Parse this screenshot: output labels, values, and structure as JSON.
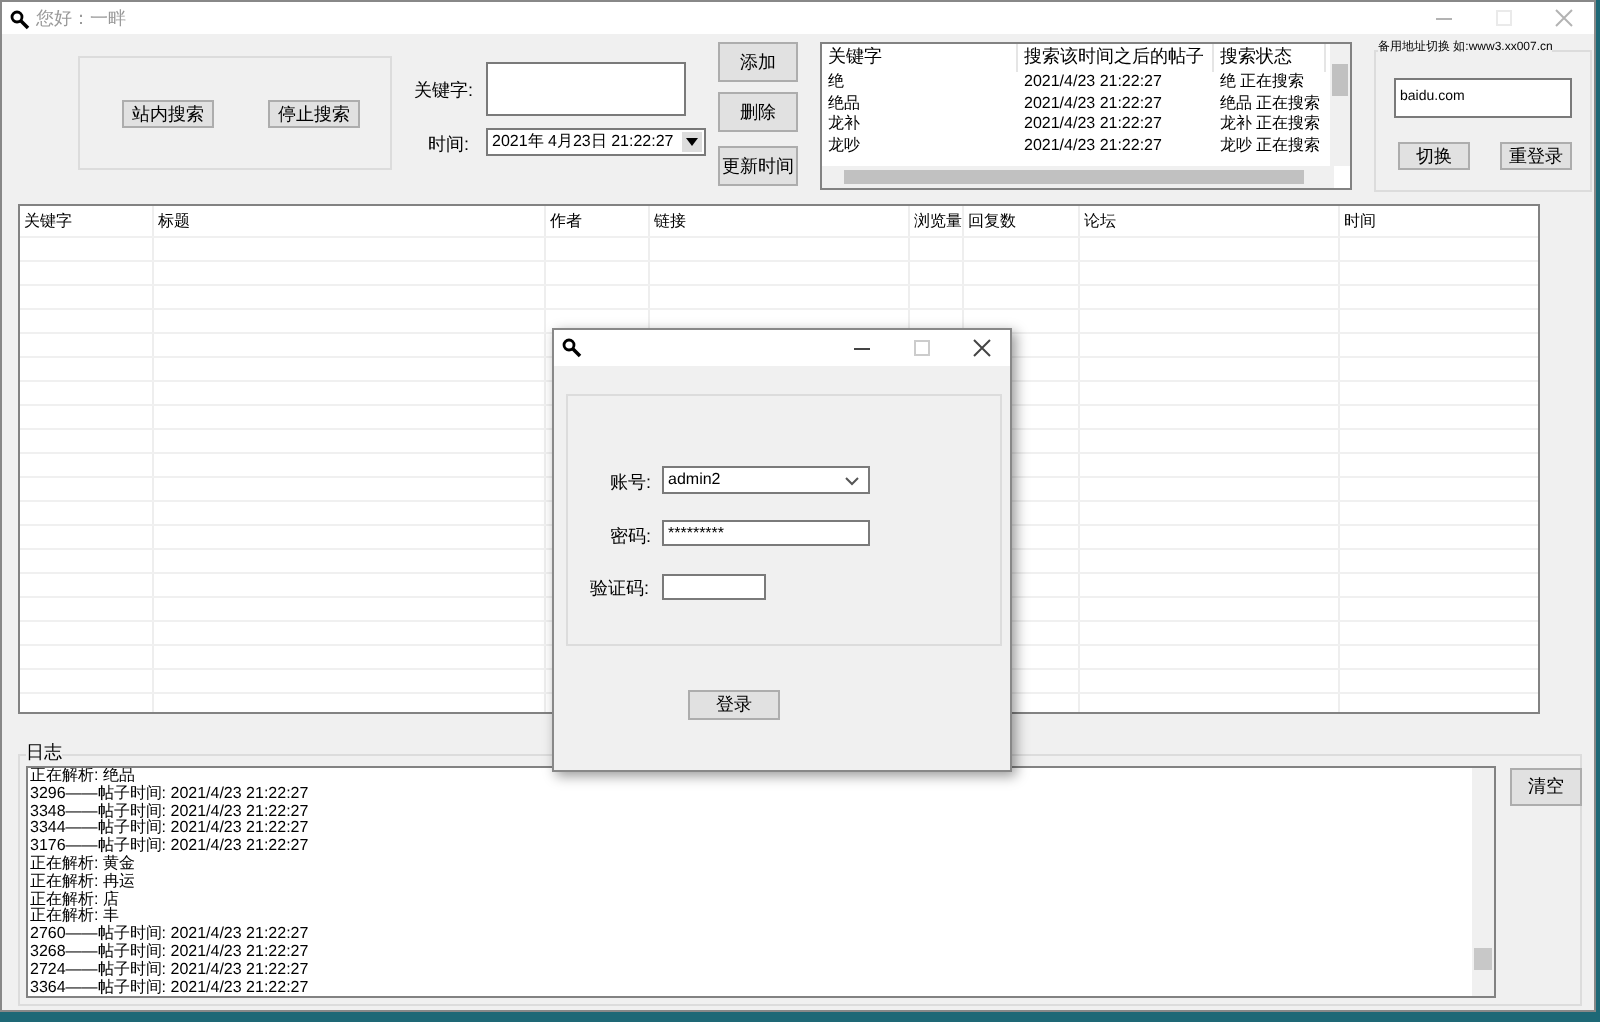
{
  "window": {
    "title": "您好：一畔"
  },
  "search_buttons": [
    "站内搜索",
    "停止搜索"
  ],
  "keyword_field": {
    "label": "关键字:"
  },
  "time_field": {
    "label": "时间:",
    "value": "2021年 4月23日 21:22:27"
  },
  "side_buttons": [
    "添加",
    "删除",
    "更新时间"
  ],
  "keyword_list": {
    "columns": [
      "关键字",
      "搜索该时间之后的帖子",
      "搜索状态"
    ],
    "rows": [
      [
        "绝",
        "2021/4/23 21:22:27",
        "绝 正在搜索"
      ],
      [
        "绝品",
        "2021/4/23 21:22:27",
        "绝品 正在搜索"
      ],
      [
        "龙补",
        "2021/4/23 21:22:27",
        "龙补 正在搜索"
      ],
      [
        "龙吵",
        "2021/4/23 21:22:27",
        "龙吵 正在搜索"
      ]
    ]
  },
  "backup": {
    "title": "备用地址切换 如:www3.xx007.cn",
    "value": "baidu.com",
    "buttons": [
      "切换",
      "重登录"
    ]
  },
  "table": {
    "columns": [
      "关键字",
      "标题",
      "作者",
      "链接",
      "浏览量",
      "回复数",
      "论坛",
      "时间"
    ]
  },
  "log": {
    "title": "日志",
    "lines": [
      "正在解析: 绝品",
      "3296——帖子时间: 2021/4/23 21:22:27",
      "3348——帖子时间: 2021/4/23 21:22:27",
      "3344——帖子时间: 2021/4/23 21:22:27",
      "3176——帖子时间: 2021/4/23 21:22:27",
      "正在解析: 黄金",
      "正在解析: 冉运",
      "正在解析: 店",
      "正在解析: 丰",
      "2760——帖子时间: 2021/4/23 21:22:27",
      "3268——帖子时间: 2021/4/23 21:22:27",
      "2724——帖子时间: 2021/4/23 21:22:27",
      "3364——帖子时间: 2021/4/23 21:22:27"
    ],
    "clear_button": "清空"
  },
  "login_dialog": {
    "account_label": "账号:",
    "account_value": "admin2",
    "password_label": "密码:",
    "password_value": "*********",
    "captcha_label": "验证码:",
    "login_button": "登录"
  }
}
